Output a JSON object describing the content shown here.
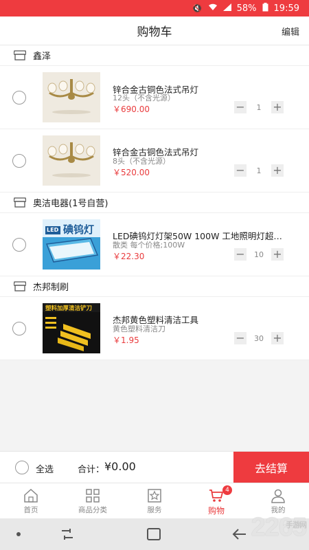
{
  "status_bar": {
    "battery": "58%",
    "time": "19:59"
  },
  "header": {
    "title": "购物车",
    "edit_label": "编辑"
  },
  "shops": [
    {
      "name": "鑫泽",
      "items": [
        {
          "name": "锌合金古铜色法式吊灯",
          "spec": "12头（不含光源）",
          "price": "￥690.00",
          "qty": "1",
          "image": "chandelier"
        },
        {
          "name": "锌合金古铜色法式吊灯",
          "spec": "8头（不含光源）",
          "price": "￥520.00",
          "qty": "1",
          "image": "chandelier"
        }
      ]
    },
    {
      "name": "奥洁电器(1号自营)",
      "items": [
        {
          "name": "LED碘钨灯灯架50W 100W 工地照明灯超亮...",
          "spec": "散类 每个价格;100W",
          "price": "￥22.30",
          "qty": "10",
          "image": "led-lamp"
        }
      ]
    },
    {
      "name": "杰邦制刷",
      "items": [
        {
          "name": "杰邦黄色塑料清洁工具",
          "spec": "黄色塑料清洁刀",
          "price": "￥1.95",
          "qty": "30",
          "image": "scraper"
        }
      ]
    }
  ],
  "product_image_text": {
    "led_title": "碘钨灯",
    "led_badge": "LED",
    "scraper_title": "塑料加厚清洁铲刀"
  },
  "bottom_bar": {
    "select_all": "全选",
    "total_label": "合计：",
    "total_value": "¥0.00",
    "checkout": "去结算"
  },
  "tabs": [
    {
      "label": "首页",
      "icon": "home-icon"
    },
    {
      "label": "商品分类",
      "icon": "grid-icon"
    },
    {
      "label": "服务",
      "icon": "star-icon"
    },
    {
      "label": "购物",
      "icon": "cart-icon",
      "badge": "4",
      "active": true
    },
    {
      "label": "我的",
      "icon": "user-icon"
    }
  ],
  "watermark": {
    "text": "2265",
    "sub": "手游网"
  },
  "colors": {
    "accent": "#ee3b3f",
    "price": "#e93b3d"
  }
}
